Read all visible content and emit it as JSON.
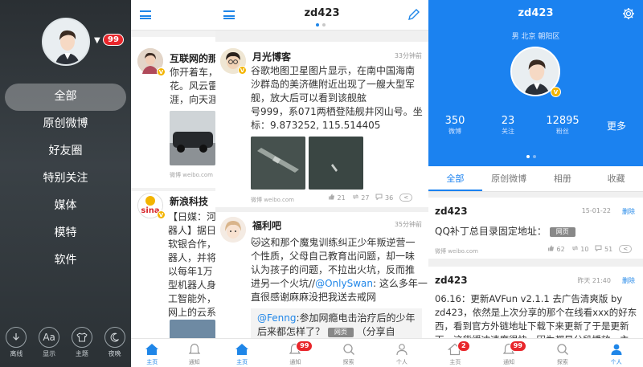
{
  "panel1": {
    "badge": "99",
    "menu": [
      "全部",
      "原创微博",
      "好友圈",
      "特别关注",
      "媒体",
      "模特",
      "软件"
    ],
    "bottom": [
      {
        "icon": "download-icon",
        "label": "离线"
      },
      {
        "icon": "font-size-icon",
        "glyph": "Aa",
        "label": "显示"
      },
      {
        "icon": "shirt-icon",
        "label": "主题"
      },
      {
        "icon": "moon-icon",
        "label": "夜晚"
      }
    ]
  },
  "panel2": {
    "posts": [
      {
        "user": "互联网的那",
        "lines": [
          "你开着车，",
          "花。风云雷",
          "涯，向天涯"
        ]
      },
      {
        "user": "新浪科技",
        "lines": [
          "【日媒：河",
          "器人】据日",
          "软银合作，",
          "器人，并将",
          "以每年1万",
          "型机器人身",
          "工智能外，",
          "网上的云系"
        ]
      }
    ],
    "source": "微博 weibo.com",
    "tabs": [
      "主页",
      "通知"
    ]
  },
  "panel3": {
    "title": "zd423",
    "posts": [
      {
        "user": "月光博客",
        "time": "33分钟前",
        "lines": [
          "谷歌地图卫星图片显示，在南中国海南",
          "沙群岛的美济礁附近出现了一艘大型军",
          "舰，放大后可以看到该舰舷",
          "号999，系071两栖登陆舰井冈山号。坐",
          "标：9.873252, 115.514405"
        ],
        "source": "微博 weibo.com",
        "stats": {
          "likes": "21",
          "reposts": "27",
          "comments": "36"
        }
      },
      {
        "user": "福利吧",
        "time": "35分钟前",
        "lines_pre": "这和那个魔鬼训练纠正少年叛逆营一",
        "lines": [
          "个性质，父母自己教育出问题，却一味",
          "认为孩子的问题，不拉出火坑，反而推",
          "进另一个火坑//"
        ],
        "mention": "@OnlySwan",
        "mention_tail": ": 这么多年一",
        "line_last": "直很感谢麻麻没把我送去戒网",
        "quote_user": "@Fenng",
        "quote_text1": ":参加网瘾电击治疗后的少年",
        "quote_text2": "后来都怎样了？",
        "quote_pill": "网页",
        "quote_tail": "（分享自"
      }
    ],
    "tabs": [
      {
        "label": "主页",
        "icon": "home-icon"
      },
      {
        "label": "通知",
        "icon": "bell-icon",
        "badge": "99"
      },
      {
        "label": "探索",
        "icon": "search-icon"
      },
      {
        "label": "个人",
        "icon": "person-icon"
      }
    ]
  },
  "panel4": {
    "title": "zd423",
    "subtitle": "男  北京 朝阳区",
    "stats": [
      {
        "num": "350",
        "label": "微博"
      },
      {
        "num": "23",
        "label": "关注"
      },
      {
        "num": "12895",
        "label": "粉丝"
      }
    ],
    "more": "更多",
    "tabs": [
      "全部",
      "原创微博",
      "相册",
      "收藏"
    ],
    "posts": [
      {
        "user": "zd423",
        "time": "15-01-22",
        "delete": "删除",
        "text": "QQ补丁总目录固定地址：",
        "pill": "网页",
        "source": "微博 weibo.com",
        "stats": {
          "likes": "62",
          "reposts": "10",
          "comments": "51"
        }
      },
      {
        "user": "zd423",
        "time": "昨天 21:40",
        "delete": "删除",
        "lines": [
          "06.16：更新AVFun v2.1.1 去广告清爽版 by",
          "zd423，依然是上次分享的那个在线看xxx的好东",
          "西，看到官方外链地址下载下来更新了于是更新",
          "下。这货缓冲速度很快，因为都是分段播放，主"
        ]
      }
    ],
    "tabsBottom": [
      {
        "label": "主页",
        "icon": "home-icon",
        "badge": "2"
      },
      {
        "label": "通知",
        "icon": "bell-icon",
        "badge": "99"
      },
      {
        "label": "探索",
        "icon": "search-icon"
      },
      {
        "label": "个人",
        "icon": "person-icon"
      }
    ]
  }
}
